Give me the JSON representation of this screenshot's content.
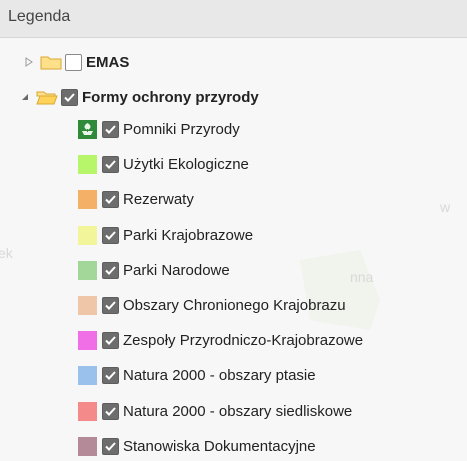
{
  "header": {
    "title": "Legenda"
  },
  "tree": {
    "emas": {
      "label": "EMAS",
      "checked": false,
      "expanded": false
    },
    "formy": {
      "label": "Formy ochrony przyrody",
      "checked": true,
      "expanded": true
    },
    "items": [
      {
        "label": "Pomniki Przyrody",
        "swatch_icon": "pomnik-przyrody-icon",
        "swatch_color": "#3a8f3a"
      },
      {
        "label": "Użytki Ekologiczne",
        "swatch_color": "#b7f56a"
      },
      {
        "label": "Rezerwaty",
        "swatch_color": "#f5b068"
      },
      {
        "label": "Parki Krajobrazowe",
        "swatch_color": "#f2f59a"
      },
      {
        "label": "Parki Narodowe",
        "swatch_color": "#a3d79a"
      },
      {
        "label": "Obszary Chronionego Krajobrazu",
        "swatch_color": "#f0c6a8"
      },
      {
        "label": "Zespoły Przyrodniczo-Krajobrazowe",
        "swatch_color": "#f06ee6"
      },
      {
        "label": "Natura 2000 - obszary ptasie",
        "swatch_color": "#9ac1ec"
      },
      {
        "label": "Natura 2000 - obszary siedliskowe",
        "swatch_color": "#f58a8a"
      },
      {
        "label": "Stanowiska Dokumentacyjne",
        "swatch_color": "#b58a98"
      }
    ]
  },
  "colors": {
    "header_bg": "#e8e8e8",
    "checkbox_checked": "#6d6d6d",
    "folder_fill": "#ffe08a",
    "folder_stroke": "#d9a930"
  }
}
